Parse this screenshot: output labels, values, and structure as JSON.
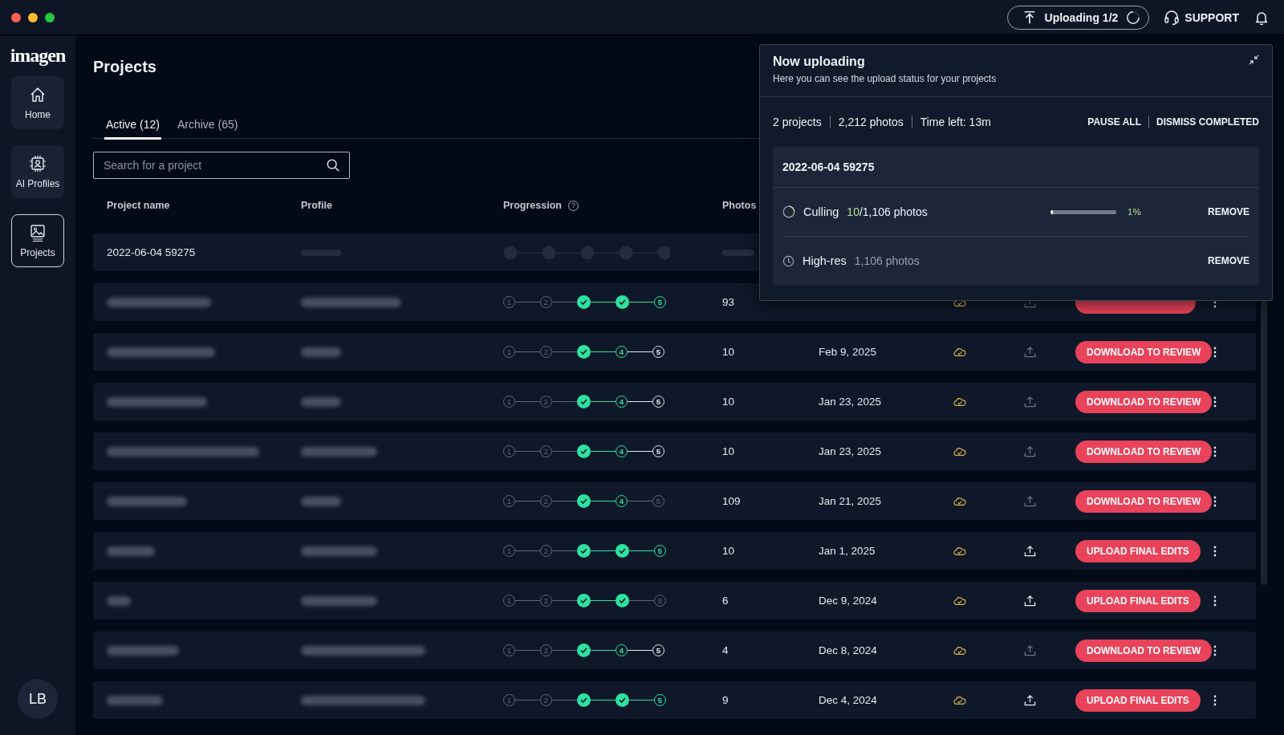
{
  "app": {
    "logo": "imagen"
  },
  "top_bar": {
    "upload_button": "Uploading 1/2",
    "support": "SUPPORT"
  },
  "sidebar": {
    "items": [
      {
        "label": "Home",
        "selected": false
      },
      {
        "label": "AI Profiles",
        "selected": false
      },
      {
        "label": "Projects",
        "selected": true
      }
    ],
    "avatar": "LB"
  },
  "page": {
    "title": "Projects",
    "tabs": [
      {
        "label": "Active (12)",
        "selected": true
      },
      {
        "label": "Archive (65)",
        "selected": false
      }
    ],
    "search": {
      "placeholder": "Search for a project"
    }
  },
  "table": {
    "columns": [
      "Project name",
      "Profile",
      "Progression",
      "Photos"
    ],
    "help_mark": "?",
    "rows": [
      {
        "kind": "loading",
        "name": "2022-06-04 59275"
      },
      {
        "kind": "project",
        "steps": [
          {
            "label": "1",
            "kind": "muted"
          },
          {
            "label": "2",
            "kind": "muted"
          },
          {
            "kind": "done"
          },
          {
            "kind": "done"
          },
          {
            "label": "5",
            "kind": "current"
          }
        ],
        "photos": "93",
        "upload_enabled": false,
        "button_covered": true
      },
      {
        "kind": "project",
        "steps": [
          {
            "label": "1",
            "kind": "muted"
          },
          {
            "label": "2",
            "kind": "muted"
          },
          {
            "kind": "done"
          },
          {
            "label": "4",
            "kind": "current"
          },
          {
            "label": "5",
            "kind": "pending"
          }
        ],
        "photos": "10",
        "date": "Feb 9, 2025",
        "upload_enabled": false,
        "button": "DOWNLOAD TO REVIEW"
      },
      {
        "kind": "project",
        "steps": [
          {
            "label": "1",
            "kind": "muted"
          },
          {
            "label": "2",
            "kind": "muted"
          },
          {
            "kind": "done"
          },
          {
            "label": "4",
            "kind": "current"
          },
          {
            "label": "5",
            "kind": "pending"
          }
        ],
        "photos": "10",
        "date": "Jan 23, 2025",
        "upload_enabled": false,
        "button": "DOWNLOAD TO REVIEW"
      },
      {
        "kind": "project",
        "steps": [
          {
            "label": "1",
            "kind": "muted"
          },
          {
            "label": "2",
            "kind": "muted"
          },
          {
            "kind": "done"
          },
          {
            "label": "4",
            "kind": "current"
          },
          {
            "label": "5",
            "kind": "pending"
          }
        ],
        "photos": "10",
        "date": "Jan 23, 2025",
        "upload_enabled": false,
        "button": "DOWNLOAD TO REVIEW"
      },
      {
        "kind": "project",
        "steps": [
          {
            "label": "1",
            "kind": "muted"
          },
          {
            "label": "2",
            "kind": "muted"
          },
          {
            "kind": "done"
          },
          {
            "label": "4",
            "kind": "current"
          },
          {
            "label": "5",
            "kind": "muted"
          }
        ],
        "photos": "109",
        "date": "Jan 21, 2025",
        "upload_enabled": false,
        "button": "DOWNLOAD TO REVIEW"
      },
      {
        "kind": "project",
        "steps": [
          {
            "label": "1",
            "kind": "muted"
          },
          {
            "label": "2",
            "kind": "muted"
          },
          {
            "kind": "done"
          },
          {
            "kind": "done"
          },
          {
            "label": "5",
            "kind": "current"
          }
        ],
        "photos": "10",
        "date": "Jan 1, 2025",
        "upload_enabled": true,
        "button": "UPLOAD FINAL EDITS"
      },
      {
        "kind": "project",
        "steps": [
          {
            "label": "1",
            "kind": "muted"
          },
          {
            "label": "2",
            "kind": "muted"
          },
          {
            "kind": "done"
          },
          {
            "kind": "done"
          },
          {
            "label": "5",
            "kind": "muted"
          }
        ],
        "photos": "6",
        "date": "Dec 9, 2024",
        "upload_enabled": true,
        "button": "UPLOAD FINAL EDITS"
      },
      {
        "kind": "project",
        "steps": [
          {
            "label": "1",
            "kind": "muted"
          },
          {
            "label": "2",
            "kind": "muted"
          },
          {
            "kind": "done"
          },
          {
            "label": "4",
            "kind": "current"
          },
          {
            "label": "5",
            "kind": "pending"
          }
        ],
        "photos": "4",
        "date": "Dec 8, 2024",
        "upload_enabled": false,
        "button": "DOWNLOAD TO REVIEW"
      },
      {
        "kind": "project",
        "steps": [
          {
            "label": "1",
            "kind": "muted"
          },
          {
            "label": "2",
            "kind": "muted"
          },
          {
            "kind": "done"
          },
          {
            "kind": "done"
          },
          {
            "label": "5",
            "kind": "current"
          }
        ],
        "photos": "9",
        "date": "Dec 4, 2024",
        "upload_enabled": true,
        "button": "UPLOAD FINAL EDITS"
      }
    ]
  },
  "upload_panel": {
    "title": "Now uploading",
    "subtitle": "Here you can see the upload status for your projects",
    "stats": [
      "2 projects",
      "2,212 photos",
      "Time left: 13m"
    ],
    "actions": [
      "PAUSE ALL",
      "DISMISS COMPLETED"
    ],
    "project": {
      "name": "2022-06-04 59275",
      "items": [
        {
          "kind": "uploading",
          "label": "Culling",
          "done": "10",
          "total": "/1,106 photos",
          "level": 0.01,
          "percent": "1%",
          "action": "REMOVE"
        },
        {
          "kind": "queued",
          "label": "High-res",
          "total": "1,106 photos",
          "action": "REMOVE"
        }
      ]
    }
  }
}
